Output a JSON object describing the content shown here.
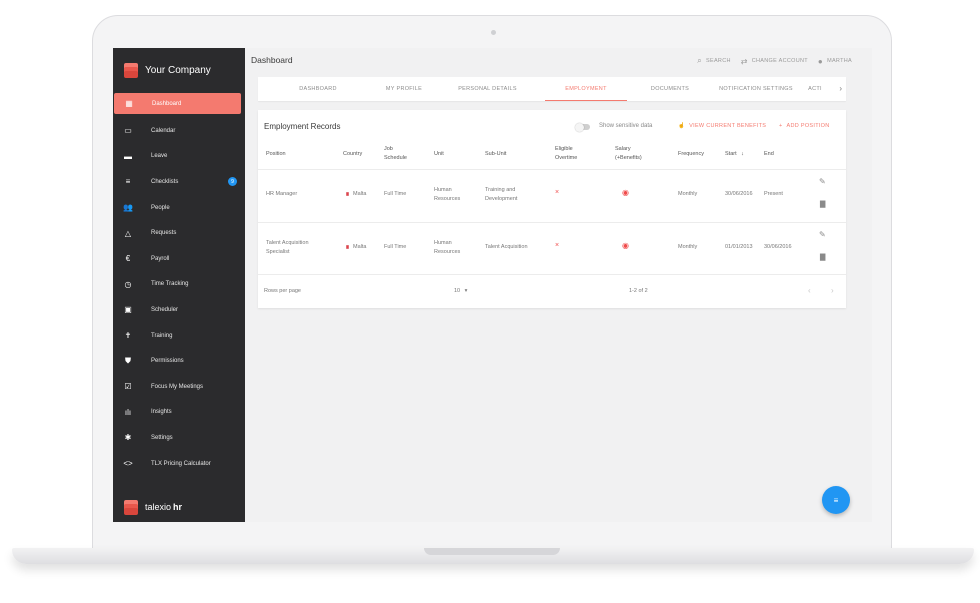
{
  "app": {
    "company_name": "Your Company",
    "product_name": "talexio",
    "product_suffix": "hr",
    "accent_color": "#f47a6f",
    "sidebar_color": "#2b2b2d",
    "info_color": "#2196f3"
  },
  "sidebar": {
    "items": [
      {
        "label": "Dashboard",
        "icon": "dashboard-icon",
        "glyph": "▦",
        "active": true
      },
      {
        "label": "Calendar",
        "icon": "calendar-icon",
        "glyph": "▭"
      },
      {
        "label": "Leave",
        "icon": "leave-icon",
        "glyph": "▬"
      },
      {
        "label": "Checklists",
        "icon": "checklist-icon",
        "glyph": "≡",
        "badge": "9"
      },
      {
        "label": "People",
        "icon": "people-icon",
        "glyph": "👥"
      },
      {
        "label": "Requests",
        "icon": "requests-icon",
        "glyph": "△"
      },
      {
        "label": "Payroll",
        "icon": "euro-icon",
        "glyph": "€"
      },
      {
        "label": "Time Tracking",
        "icon": "timer-icon",
        "glyph": "◷"
      },
      {
        "label": "Scheduler",
        "icon": "scheduler-icon",
        "glyph": "▣"
      },
      {
        "label": "Training",
        "icon": "training-icon",
        "glyph": "✝"
      },
      {
        "label": "Permissions",
        "icon": "shield-icon",
        "glyph": "⛊"
      },
      {
        "label": "Focus My Meetings",
        "icon": "meetings-icon",
        "glyph": "☑"
      },
      {
        "label": "Insights",
        "icon": "insights-icon",
        "glyph": "ılı"
      },
      {
        "label": "Settings",
        "icon": "gear-icon",
        "glyph": "✱"
      },
      {
        "label": "TLX Pricing Calculator",
        "icon": "code-icon",
        "glyph": "<>"
      }
    ]
  },
  "header": {
    "title": "Dashboard",
    "search_label": "SEARCH",
    "change_account_label": "CHANGE ACCOUNT",
    "user_label": "MARTHA"
  },
  "tabs": [
    {
      "label": "DASHBOARD"
    },
    {
      "label": "MY PROFILE"
    },
    {
      "label": "PERSONAL DETAILS"
    },
    {
      "label": "EMPLOYMENT",
      "active": true
    },
    {
      "label": "DOCUMENTS"
    },
    {
      "label": "NOTIFICATION SETTINGS"
    },
    {
      "label": "ACTI"
    }
  ],
  "employment": {
    "title": "Employment Records",
    "toggle_label": "Show sensitive data",
    "view_benefits_label": "VIEW CURRENT BENEFITS",
    "add_position_label": "ADD POSITION",
    "columns": {
      "position": "Position",
      "country": "Country",
      "job_schedule_1": "Job",
      "job_schedule_2": "Schedule",
      "unit": "Unit",
      "sub_unit": "Sub-Unit",
      "eligible_1": "Eligible",
      "eligible_2": "Overtime",
      "salary_1": "Salary",
      "salary_2": "(+Benefits)",
      "frequency": "Frequency",
      "start": "Start",
      "end": "End"
    },
    "rows": [
      {
        "position_1": "HR Manager",
        "position_2": "",
        "country": "Malta",
        "schedule": "Full Time",
        "unit_1": "Human",
        "unit_2": "Resources",
        "sub_unit_1": "Training and",
        "sub_unit_2": "Development",
        "eligible": "×",
        "frequency": "Monthly",
        "start": "30/06/2016",
        "end": "Present"
      },
      {
        "position_1": "Talent Acquisition",
        "position_2": "Specialist",
        "country": "Malta",
        "schedule": "Full Time",
        "unit_1": "Human",
        "unit_2": "Resources",
        "sub_unit_1": "Talent Acquisition",
        "sub_unit_2": "",
        "eligible": "×",
        "frequency": "Monthly",
        "start": "01/01/2013",
        "end": "30/06/2016"
      }
    ],
    "footer": {
      "rows_per_page_label": "Rows per page",
      "rows_per_page_value": "10",
      "range": "1-2 of 2"
    }
  }
}
